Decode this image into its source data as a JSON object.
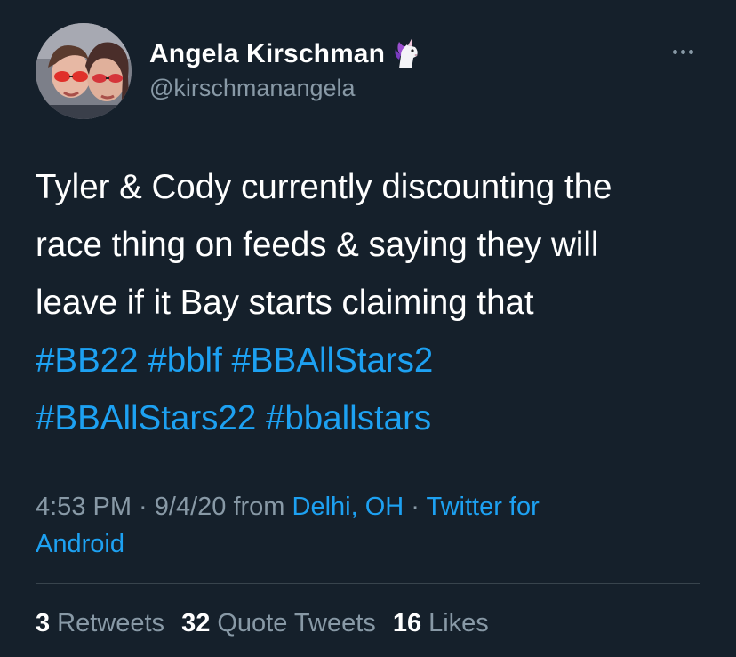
{
  "tweet": {
    "author": {
      "display_name": "Angela Kirschman",
      "name_emoji": "unicorn-icon",
      "handle": "@kirschmanangela"
    },
    "text_lines": [
      "Tyler & Cody currently discounting the",
      "race thing on feeds & saying they will",
      "leave if it Bay starts claiming that"
    ],
    "hashtags": {
      "bb22": "#BB22",
      "bblf": "#bblf",
      "bballstars2": "#BBAllStars2",
      "bballstars22": "#BBAllStars22",
      "bballstars": "#bballstars"
    },
    "meta": {
      "time_date": "4:53 PM · 9/4/20 from ",
      "location": "Delhi, OH",
      "separator": " · ",
      "source_part1": "Twitter for",
      "source_part2": "Android"
    },
    "stats": {
      "retweets_count": "3",
      "retweets_label": "Retweets",
      "quotes_count": "32",
      "quotes_label": "Quote Tweets",
      "likes_count": "16",
      "likes_label": "Likes"
    }
  },
  "colors": {
    "background": "#15202b",
    "text": "#ffffff",
    "secondary_text": "#8899a6",
    "link": "#1da1f2",
    "divider": "#38444d"
  }
}
